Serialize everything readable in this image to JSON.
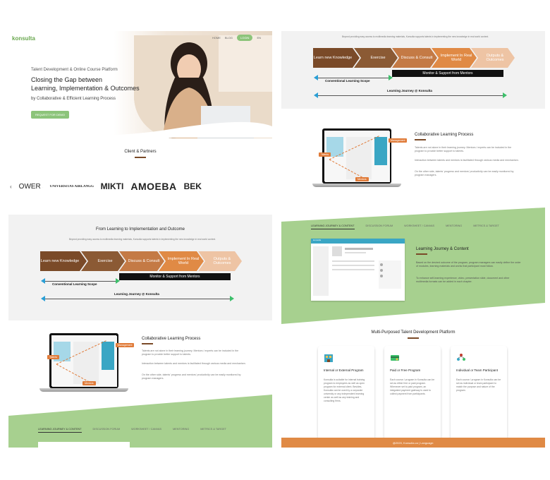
{
  "brand": {
    "name": "konsulta",
    "accent": "#6aa84f",
    "orange": "#e07b39",
    "brown": "#7a4a28",
    "green": "#a7d08f"
  },
  "nav": {
    "items": [
      "HOME",
      "BLOG",
      "LOGIN",
      "EN"
    ]
  },
  "hero": {
    "subtitle": "Talent Development & Online Course Platform",
    "title_line1": "Closing the Gap between",
    "title_line2": "Learning, Implementation & Outcomes",
    "tagline": "by Collaborative & Efficient Learning Process",
    "cta": "REQUEST FOR DEMO"
  },
  "partners": {
    "title": "Client & Partners",
    "logos": [
      "OWER academy",
      "UNIVERSITAS AIRLANGGA",
      "MIKTI",
      "AMOEBA",
      "BEK"
    ]
  },
  "flow": {
    "title": "From Learning to Implementation and Outcome",
    "intro": "Beyond providing easy access to multimedia learning materials, Konsulta supports talents in implementing the new knowledge in real world context.",
    "steps": [
      "Learn new Knowledge",
      "Exercise",
      "Discuss & Consult",
      "Implement In Real World",
      "Outputs & Outcomes"
    ],
    "monitor": "Monitor & Support from Mentors",
    "scope": "Conventional Learning Scope",
    "journey": "Learning Journey @ Konsulta"
  },
  "collab": {
    "title": "Collaborative Learning Process",
    "p1": "Talents are not alone in their learning journey. Mentors / experts can be included in the program to provide better support to talents.",
    "p2": "Interaction between talents and mentors is facilitated through various media and mechanism.",
    "p3": "On the other side, talents' progress and mentors' productivity can be easily monitored by program managers.",
    "tags": [
      "Talents",
      "Management",
      "Mentors"
    ]
  },
  "tabs": [
    "LEARNING JOURNEY & CONTENT",
    "DISCUSSION FORUM",
    "WORKSHEET / CANVAS",
    "MENTORING",
    "METRICS & TARGET"
  ],
  "journey_content": {
    "title": "Learning Journey & Content",
    "p1": "Based on the desired outcome of the program, program managers can easily define the order of modules, learning materials and works that participant must follow.",
    "p2": "To enhance self-learning experience, video, presentation slide, document and other multimedia formats can be added in each chapter."
  },
  "platform": {
    "title": "Multi-Purposed Talent Development Platform",
    "cards": [
      {
        "title": "Internal or External Program",
        "text": "Konsulta is suitable for internal training program to employees as well as open program for external client. Besides, Konsulta can be used by a corporate university or any independent learning center as well as any training and consulting firms."
      },
      {
        "title": "Paid or Free Program",
        "text": "Each course / program in Konsulta can be set as either free or paid program. Whenever set to paid program, an integrated payment gateway is used to collect payment from participants."
      },
      {
        "title": "Individual or Team Participant",
        "text": "Each course / program in Konsulta can be set as individual or team participant to match the purpose and nature of the program."
      }
    ]
  },
  "footer": "@2020, Konsulta.co | Language:"
}
